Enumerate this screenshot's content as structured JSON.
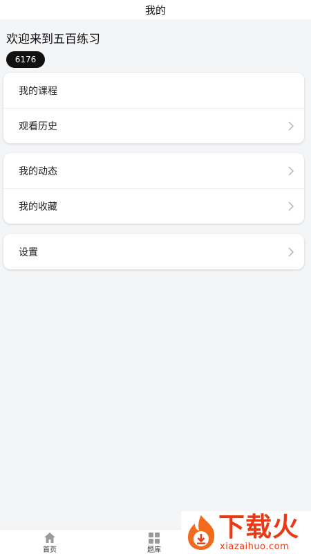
{
  "header": {
    "title": "我的"
  },
  "profile": {
    "welcome": "欢迎来到五百练习",
    "user_id": "6176"
  },
  "groups": [
    {
      "items": [
        {
          "label": "我的课程",
          "chevron": false
        },
        {
          "label": "观看历史",
          "chevron": true
        }
      ]
    },
    {
      "items": [
        {
          "label": "我的动态",
          "chevron": true
        },
        {
          "label": "我的收藏",
          "chevron": true
        }
      ]
    },
    {
      "items": [
        {
          "label": "设置",
          "chevron": true
        }
      ]
    }
  ],
  "nav": {
    "home": {
      "label": "首页",
      "icon": "home-icon"
    },
    "questions": {
      "label": "题库",
      "icon": "grid-icon"
    }
  },
  "watermark": {
    "brand": "下载火",
    "site": "xiazaihuo.com",
    "color": "#e83a17"
  }
}
